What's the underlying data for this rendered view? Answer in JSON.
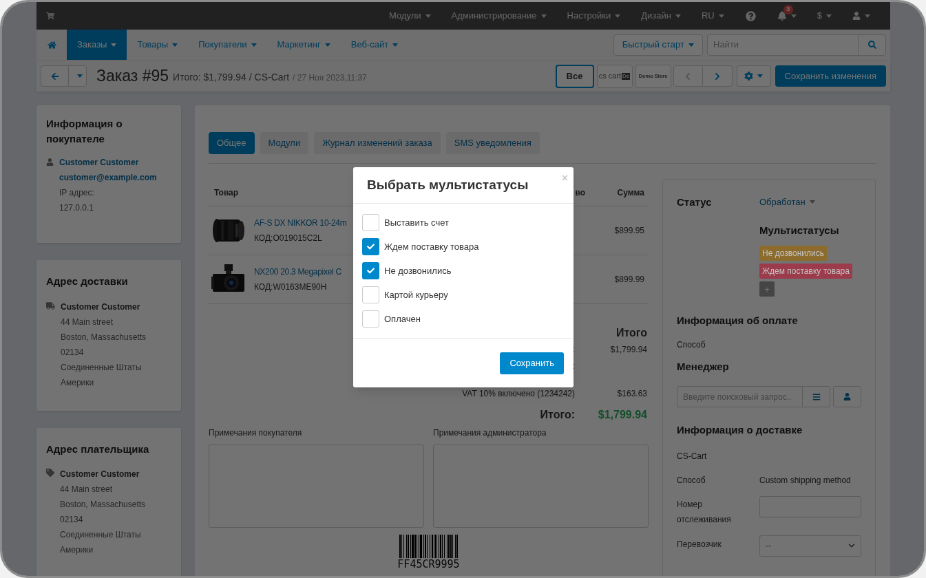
{
  "topbar": {
    "menus": [
      {
        "label": "Модули"
      },
      {
        "label": "Администрирование"
      },
      {
        "label": "Настройки"
      },
      {
        "label": "Дизайн"
      },
      {
        "label": "RU"
      }
    ],
    "notification_count": "3",
    "currency": "$"
  },
  "nav": {
    "items": [
      {
        "label": "Заказы",
        "selected": true
      },
      {
        "label": "Товары",
        "selected": false
      },
      {
        "label": "Покупатели",
        "selected": false
      },
      {
        "label": "Маркетинг",
        "selected": false
      },
      {
        "label": "Веб-сайт",
        "selected": false
      }
    ],
    "quick_start": "Быстрый старт",
    "search": {
      "placeholder": "Найти"
    }
  },
  "header": {
    "title": "Заказ #95",
    "summary": "Итого: $1,799.94 / CS-Cart",
    "date": "/ 27 Ноя 2023,11:37",
    "storefronts": [
      {
        "kind": "text",
        "label": "Все",
        "selected": true
      },
      {
        "kind": "logo",
        "label": "cs cart",
        "badge": "De",
        "selected": false
      },
      {
        "kind": "small",
        "label": "Demo Store",
        "selected": false
      }
    ],
    "save": "Сохранить изменения"
  },
  "customer": {
    "title": "Информация о покупателе",
    "name": "Customer Customer",
    "email": "customer@example.com",
    "ip_label": "IP адрес:",
    "ip": "127.0.0.1"
  },
  "addresses": [
    {
      "kind": "shipping",
      "title": "Адрес доставки",
      "name": "Customer Customer",
      "lines": [
        "44 Main street",
        "Boston, Massachusetts",
        "02134",
        "Соединенные Штаты Америки"
      ]
    },
    {
      "kind": "billing",
      "title": "Адрес плательщика",
      "name": "Customer Customer",
      "lines": [
        "44 Main street",
        "Boston, Massachusetts",
        "02134",
        "Соединенные Штаты Америки"
      ]
    }
  ],
  "tabs": [
    {
      "label": "Общее",
      "selected": true
    },
    {
      "label": "Модули",
      "selected": false
    },
    {
      "label": "Журнал изменений заказа",
      "selected": false
    },
    {
      "label": "SMS уведомления",
      "selected": false
    }
  ],
  "table": {
    "columns": [
      "Товар",
      "во",
      "Сумма"
    ],
    "rows": [
      {
        "kind": "lens",
        "name": "AF-S DX NIKKOR 10-24m",
        "code": "КОД:O019015C2L",
        "sum": "$899.95"
      },
      {
        "kind": "camera",
        "name": "NX200 20.3 Megapixel C",
        "code": "КОД:W0163ME90H",
        "sum": "$899.99"
      }
    ]
  },
  "totals": {
    "title": "Итого",
    "rows": [
      {
        "label": ":",
        "value": "$1,799.94"
      },
      {
        "label": ":"
      },
      {
        "label": "VAT 10% включено (1234242)",
        "value": "$163.63"
      }
    ],
    "grand_label": "Итого:",
    "grand_value": "$1,799.94"
  },
  "notes": [
    {
      "label": "Примечания покупателя"
    },
    {
      "label": "Примечания администратора"
    }
  ],
  "barcode": "FF45CR9995",
  "sidebar": {
    "status_label": "Статус",
    "status_value": "Обработан",
    "multistatus_title": "Мультистатусы",
    "tags": [
      {
        "label": "Не дозвонились",
        "color": "#8c6b2d"
      },
      {
        "label": "Ждем поставку товара",
        "color": "#9b3b4b"
      }
    ],
    "add": "+",
    "payment_title": "Информация об оплате",
    "payment_method_label": "Способ",
    "manager_title": "Менеджер",
    "manager_placeholder": "Введите поисковый запрос..",
    "shipping_title": "Информация о доставке",
    "carrier_name": "CS-Cart",
    "shipping_method_label": "Способ",
    "shipping_method": "Custom shipping method",
    "tracking_label": "Номер отслеживания",
    "carrier_label": "Перевозчик",
    "carrier_value": "--"
  },
  "modal": {
    "title": "Выбрать мультистатусы",
    "close": "×",
    "options": [
      {
        "label": "Выставить счет",
        "checked": false
      },
      {
        "label": "Ждем поставку товара",
        "checked": true
      },
      {
        "label": "Не дозвонились",
        "checked": true
      },
      {
        "label": "Картой курьеру",
        "checked": false
      },
      {
        "label": "Оплачен",
        "checked": false
      }
    ],
    "save": "Сохранить"
  }
}
